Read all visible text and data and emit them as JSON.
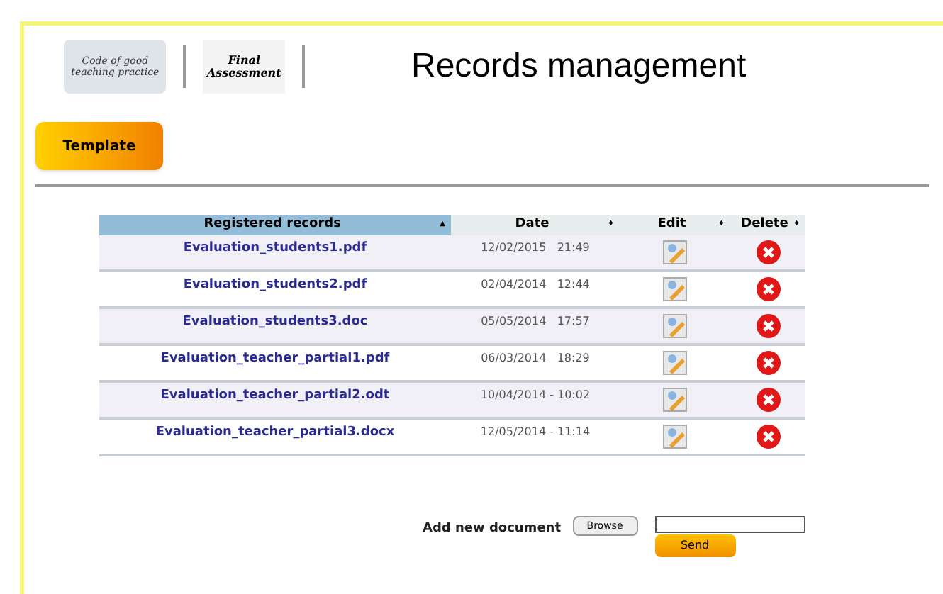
{
  "logos": [
    {
      "text": "Code of good teaching practice"
    },
    {
      "text": "Final Assessment"
    }
  ],
  "title": "Records management",
  "template_button": "Template",
  "table": {
    "columns": [
      {
        "label": "Registered records",
        "sort": "▲",
        "selected": true
      },
      {
        "label": "Date",
        "sort": "♦",
        "selected": false
      },
      {
        "label": "Edit",
        "sort": "♦",
        "selected": false
      },
      {
        "label": "Delete",
        "sort": "♦",
        "selected": false
      }
    ],
    "rows": [
      {
        "name": "Evaluation_students1.pdf",
        "date": "12/02/2015   21:49"
      },
      {
        "name": "Evaluation_students2.pdf",
        "date": "02/04/2014   12:44"
      },
      {
        "name": "Evaluation_students3.doc",
        "date": "05/05/2014   17:57"
      },
      {
        "name": "Evaluation_teacher_partial1.pdf",
        "date": "06/03/2014   18:29"
      },
      {
        "name": "Evaluation_teacher_partial2.odt",
        "date": "10/04/2014 - 10:02"
      },
      {
        "name": "Evaluation_teacher_partial3.docx",
        "date": "12/05/2014 - 11:14"
      }
    ]
  },
  "upload": {
    "label": "Add new document",
    "browse": "Browse",
    "send": "Send"
  }
}
